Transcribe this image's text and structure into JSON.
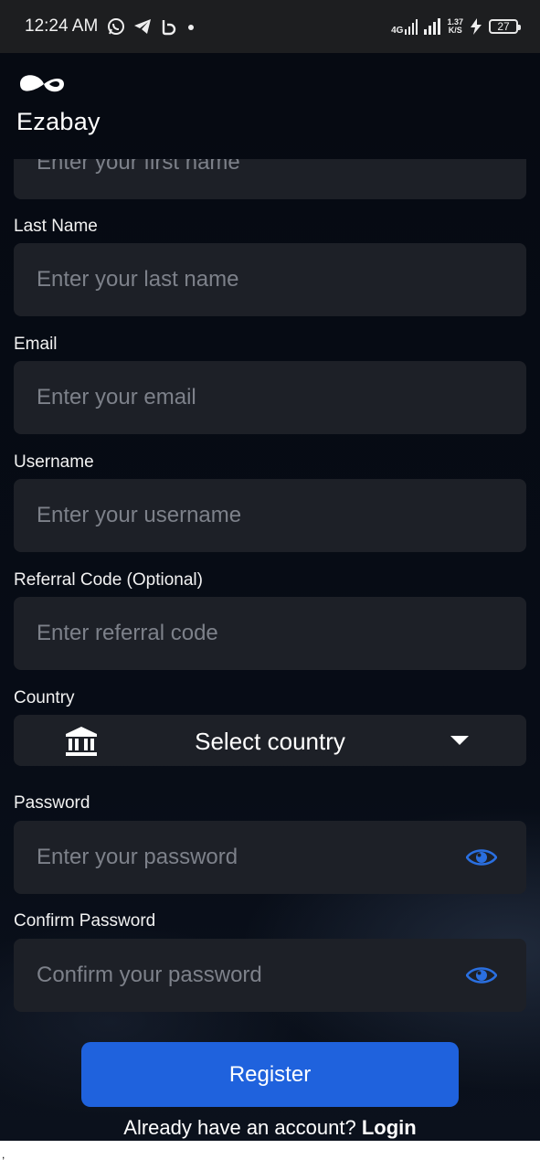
{
  "status_bar": {
    "time": "12:24 AM",
    "network": "4G",
    "speed_value": "1.37",
    "speed_unit": "K/S",
    "battery": "27"
  },
  "app": {
    "brand": "Ezabay"
  },
  "form": {
    "first_name": {
      "placeholder": "Enter your first name"
    },
    "last_name": {
      "label": "Last Name",
      "placeholder": "Enter your last name"
    },
    "email": {
      "label": "Email",
      "placeholder": "Enter your email"
    },
    "username": {
      "label": "Username",
      "placeholder": "Enter your username"
    },
    "referral": {
      "label": "Referral Code (Optional)",
      "placeholder": "Enter referral code"
    },
    "country": {
      "label": "Country",
      "value": "Select country"
    },
    "password": {
      "label": "Password",
      "placeholder": "Enter your password"
    },
    "confirm_password": {
      "label": "Confirm Password",
      "placeholder": "Confirm your password"
    },
    "register_label": "Register",
    "login_prompt": "Already have an account?",
    "login_link": "Login"
  },
  "icons": {
    "eye": "eye-icon",
    "bank": "bank-icon",
    "dropdown": "chevron-down-icon"
  },
  "colors": {
    "accent": "#1f62dd",
    "eye_icon": "#2a6fe0",
    "input_bg": "#1d2027",
    "background": "#060a12"
  },
  "bottom_mark": ","
}
